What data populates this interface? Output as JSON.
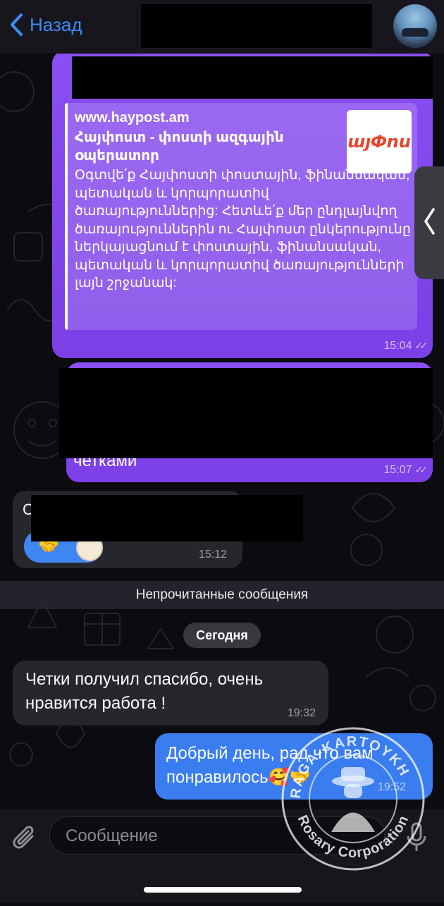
{
  "header": {
    "back_label": "Назад"
  },
  "messages": {
    "link": {
      "time": "15:04",
      "preview_site": "www.haypost.am",
      "preview_title": "Հայփոստ - փոստի ազգային օպերատոր",
      "preview_description": "Օգտվե՛ք Հայփոստի փոստային, ֆինանսական, պետական և կորպորատիվ ծառայություններից: Հետևե՛ք մեր ընդլայնվող ծառայություններին ու Հայփոստ ընկերությունը ներկայացնում է փոստային, ֆինանսական, պետական և կորպորատիվ ծառայությունների լայն շրջանակ:",
      "thumb_logo_text": "այՓոս"
    },
    "second": {
      "partial_text": "четками",
      "time": "15:07"
    },
    "third": {
      "partial_text": "С",
      "time": "15:12",
      "reaction_emoji": "🤝"
    },
    "unread_banner": "Непрочитанные сообщения",
    "date_separator": "Сегодня",
    "incoming_today": {
      "text": "Четки получил спасибо, очень нравится работа !",
      "time": "19:32"
    },
    "outgoing_today": {
      "text": "Добрый день, рад что вам понравилось🥰🤝",
      "time": "19:52"
    }
  },
  "composer": {
    "placeholder": "Сообщение"
  },
  "watermark": {
    "top_text": "RAGA-KARTOYKH",
    "bottom_text": "Rosary Corporation"
  },
  "colors": {
    "accent": "#3c8ef6",
    "outgoing_bubble": "#8a4ff2",
    "incoming_bubble": "#26262d",
    "background": "#0b0b10"
  }
}
